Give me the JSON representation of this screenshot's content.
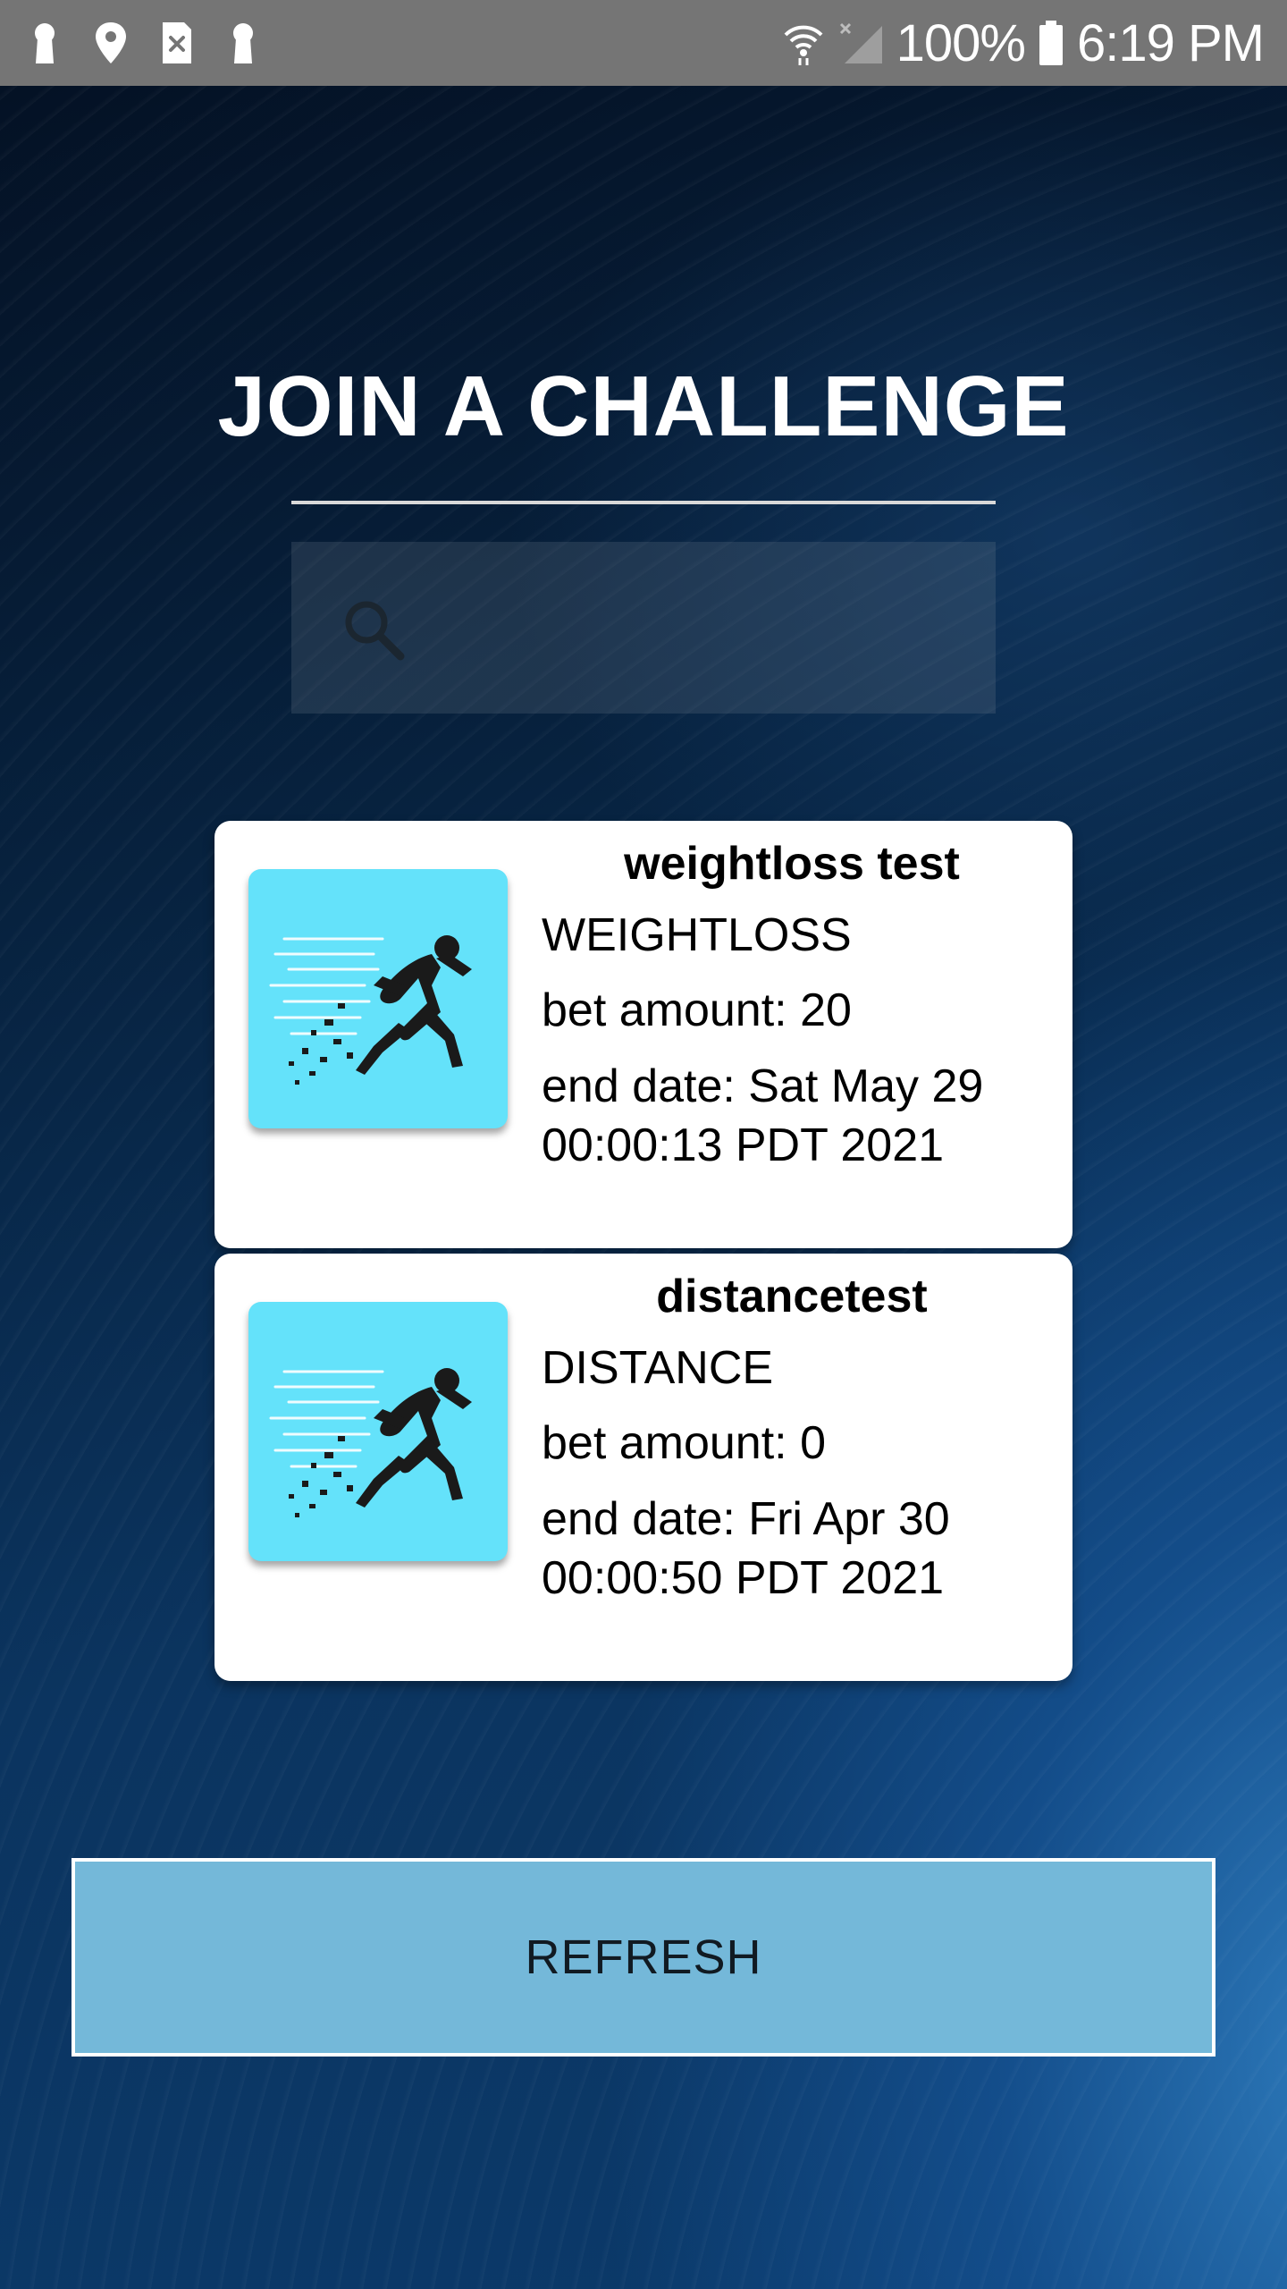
{
  "status_bar": {
    "battery": "100%",
    "time": "6:19 PM",
    "left_icons": [
      "keyhole-icon",
      "location-pin-icon",
      "sim-error-icon",
      "keyhole-icon"
    ],
    "right_icons": [
      "wifi-icon",
      "signal-off-icon",
      "battery-icon"
    ]
  },
  "page": {
    "title": "JOIN A CHALLENGE"
  },
  "search": {
    "placeholder": "",
    "value": "",
    "icon": "search-icon"
  },
  "challenges": [
    {
      "name": "weightloss test",
      "type": "WEIGHTLOSS",
      "bet_amount": "bet amount: 20",
      "end_date": "end date: Sat May 29 00:00:13 PDT 2021",
      "icon": "sprinter-icon"
    },
    {
      "name": "distancetest",
      "type": "DISTANCE",
      "bet_amount": "bet amount: 0",
      "end_date": "end date: Fri Apr 30 00:00:50 PDT 2021",
      "icon": "sprinter-icon"
    }
  ],
  "actions": {
    "refresh_label": "REFRESH"
  },
  "colors": {
    "status_bar": "#757575",
    "card_thumb": "#64e2fa",
    "refresh_button": "#74b8d9",
    "background_dark": "#06172e",
    "background_accent": "#2e7cbe"
  }
}
